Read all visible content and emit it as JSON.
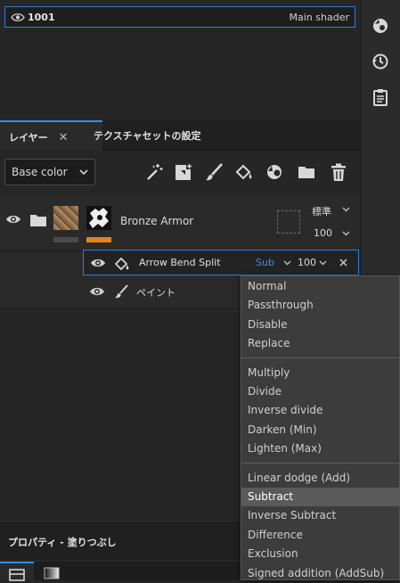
{
  "texture_set": {
    "name": "1001",
    "shader": "Main shader"
  },
  "tabs": [
    {
      "label": "レイヤー"
    },
    {
      "label": "テクスチャセットの設定"
    }
  ],
  "tab_close_glyph": "✕",
  "channel_select": {
    "value": "Base color"
  },
  "layers": [
    {
      "name": "Bronze Armor",
      "blend": "標準",
      "opacity": "100"
    },
    {
      "name": "Arrow Bend Split",
      "blend": "Sub",
      "opacity": "100"
    },
    {
      "name": "ペイント"
    }
  ],
  "properties_header": {
    "title": "プロパティ - 塗りつぶし"
  },
  "blend_menu": {
    "groups": [
      [
        "Normal",
        "Passthrough",
        "Disable",
        "Replace"
      ],
      [
        "Multiply",
        "Divide",
        "Inverse divide",
        "Darken (Min)",
        "Lighten (Max)"
      ],
      [
        "Linear dodge (Add)",
        "Subtract",
        "Inverse Subtract",
        "Difference",
        "Exclusion",
        "Signed addition (AddSub)"
      ]
    ],
    "selected": "Subtract"
  },
  "colors": {
    "accent_blue": "#2f7fd8",
    "accent_orange": "#e8821e",
    "menu_bg": "#3c3c3c",
    "blend_blue": "#3c8ee8"
  },
  "icons": {
    "right_toolbar": [
      "shader-sphere-icon",
      "history-icon",
      "log-clipboard-icon"
    ],
    "layer_tools": [
      "magic-wand-icon",
      "add-mask-icon",
      "paint-brush-icon",
      "fill-bucket-icon",
      "smart-material-icon",
      "folder-icon",
      "trash-icon"
    ]
  }
}
